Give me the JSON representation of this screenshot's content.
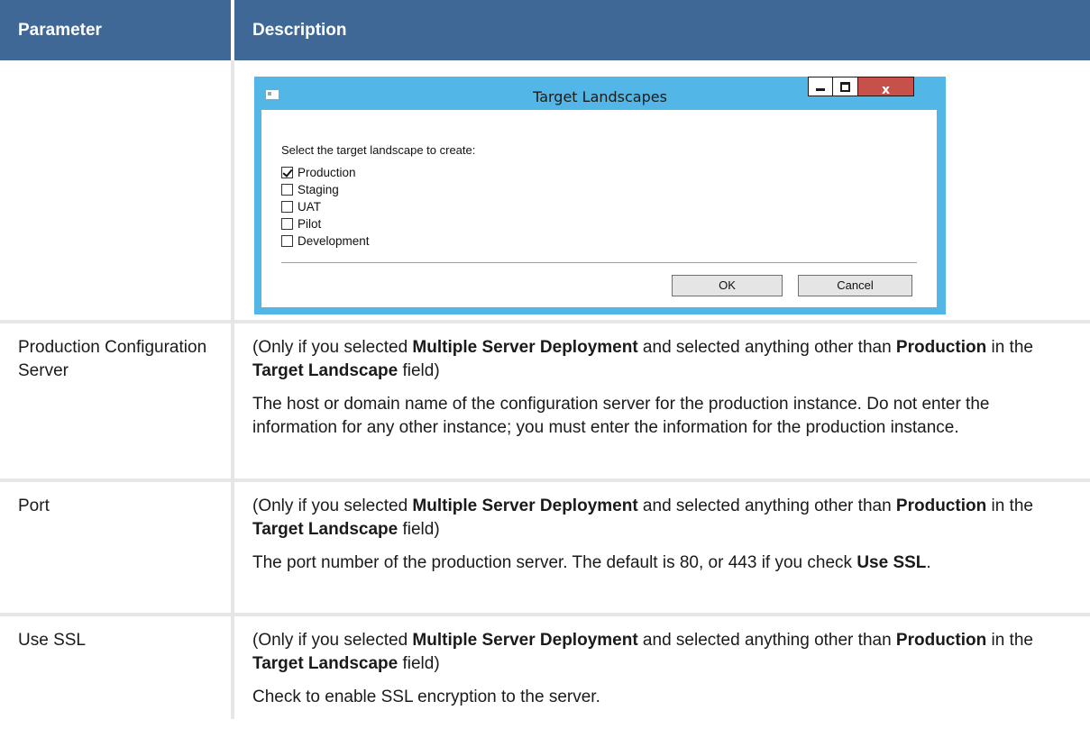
{
  "table": {
    "headers": {
      "parameter": "Parameter",
      "description": "Description"
    },
    "rows": [
      {
        "parameter": "",
        "image": {
          "title": "Target Landscapes",
          "close_label": "x",
          "prompt": "Select the target landscape to create:",
          "options": [
            {
              "label": "Production",
              "checked": true
            },
            {
              "label": "Staging",
              "checked": false
            },
            {
              "label": "UAT",
              "checked": false
            },
            {
              "label": "Pilot",
              "checked": false
            },
            {
              "label": "Development",
              "checked": false
            }
          ],
          "ok_label": "OK",
          "cancel_label": "Cancel"
        }
      },
      {
        "parameter": "Production Configuration Server",
        "desc_parts": [
          "(Only if you selected ",
          "Multiple Server Deployment",
          " and selected anything other than ",
          "Production",
          " in the ",
          "Target Landscape",
          " field)"
        ],
        "desc_body": "The host or domain name of the configuration server for the production instance. Do not enter the information for any other instance; you must enter the information for the production instance."
      },
      {
        "parameter": "Port",
        "desc_parts": [
          "(Only if you selected ",
          "Multiple Server Deployment",
          " and selected anything other than ",
          "Production",
          " in the ",
          "Target Landscape",
          " field)"
        ],
        "desc_body_parts": [
          "The port number of the production server. The default is 80, or 443 if you check ",
          "Use SSL",
          "."
        ]
      },
      {
        "parameter": "Use SSL",
        "desc_parts": [
          "(Only if you selected ",
          "Multiple Server Deployment",
          " and selected anything other than ",
          "Production",
          " in the ",
          "Target Landscape",
          " field)"
        ],
        "desc_body": "Check to enable SSL encryption to the server."
      }
    ]
  },
  "colors": {
    "header_bg": "#3f6896",
    "header_text": "#ffffff",
    "cell_border": "#e6e6e6",
    "dialog_frame": "#52b6e6",
    "close_button": "#c7504a"
  }
}
